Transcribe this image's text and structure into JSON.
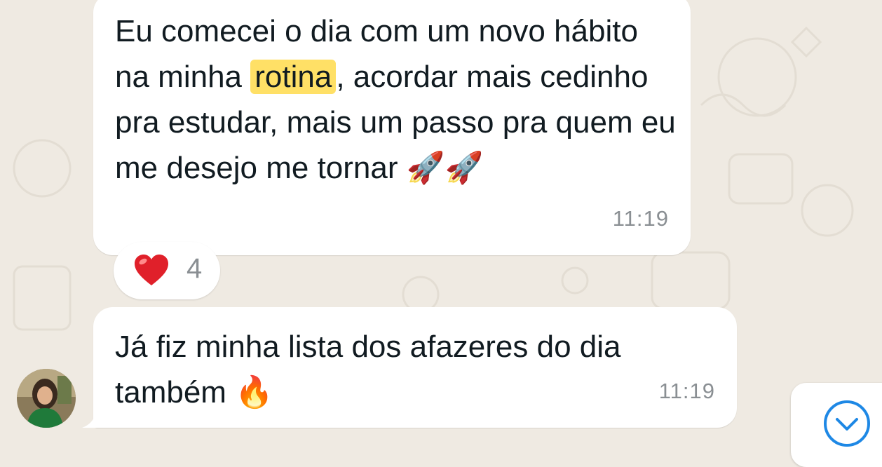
{
  "messages": [
    {
      "text_before": "Eu comecei o dia com um novo hábito na minha ",
      "highlight": "rotina",
      "text_after": ", acordar mais cedinho pra estudar, mais um passo pra quem eu me desejo me tornar ",
      "emoji": "🚀🚀",
      "time": "11:19",
      "reaction": {
        "emoji": "❤️",
        "count": "4"
      }
    },
    {
      "text": "Já fiz minha lista dos afazeres do dia também ",
      "emoji": "🔥",
      "time": "11:19"
    }
  ],
  "colors": {
    "background": "#efeae2",
    "bubble": "#ffffff",
    "highlight": "#ffe066",
    "time": "#8a8f93",
    "accent": "#1e88e5"
  },
  "icons": {
    "reaction": "heart-icon",
    "scroll": "chevron-down-icon"
  }
}
